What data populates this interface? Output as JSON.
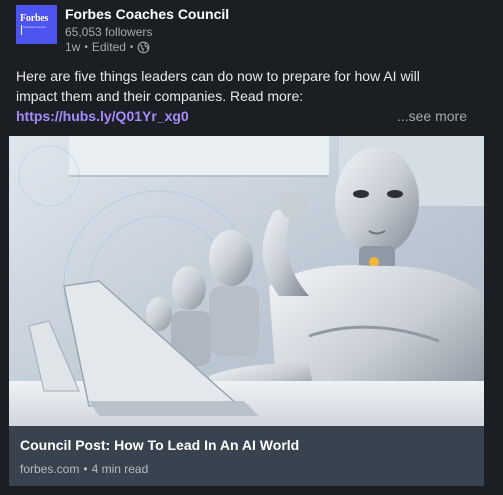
{
  "post": {
    "org_name": "Forbes Coaches Council",
    "followers": "65,053 followers",
    "age": "1w",
    "edited": "Edited",
    "logo_brand": "Forbes",
    "logo_sub": "Coaches Council",
    "text": "Here are five things leaders can do now to prepare for how AI will impact them and their companies. Read more:",
    "link": "https://hubs.ly/Q01Yr_xg0",
    "see_more": "...see more"
  },
  "article": {
    "title": "Council Post: How To Lead In An AI World",
    "domain": "forbes.com",
    "read_time": "4 min read"
  },
  "icons": {
    "visibility": "globe-icon"
  },
  "colors": {
    "background": "#1b1f23",
    "logo": "#4e54f0",
    "link": "#a78bfa",
    "article_bar": "#38434f"
  }
}
